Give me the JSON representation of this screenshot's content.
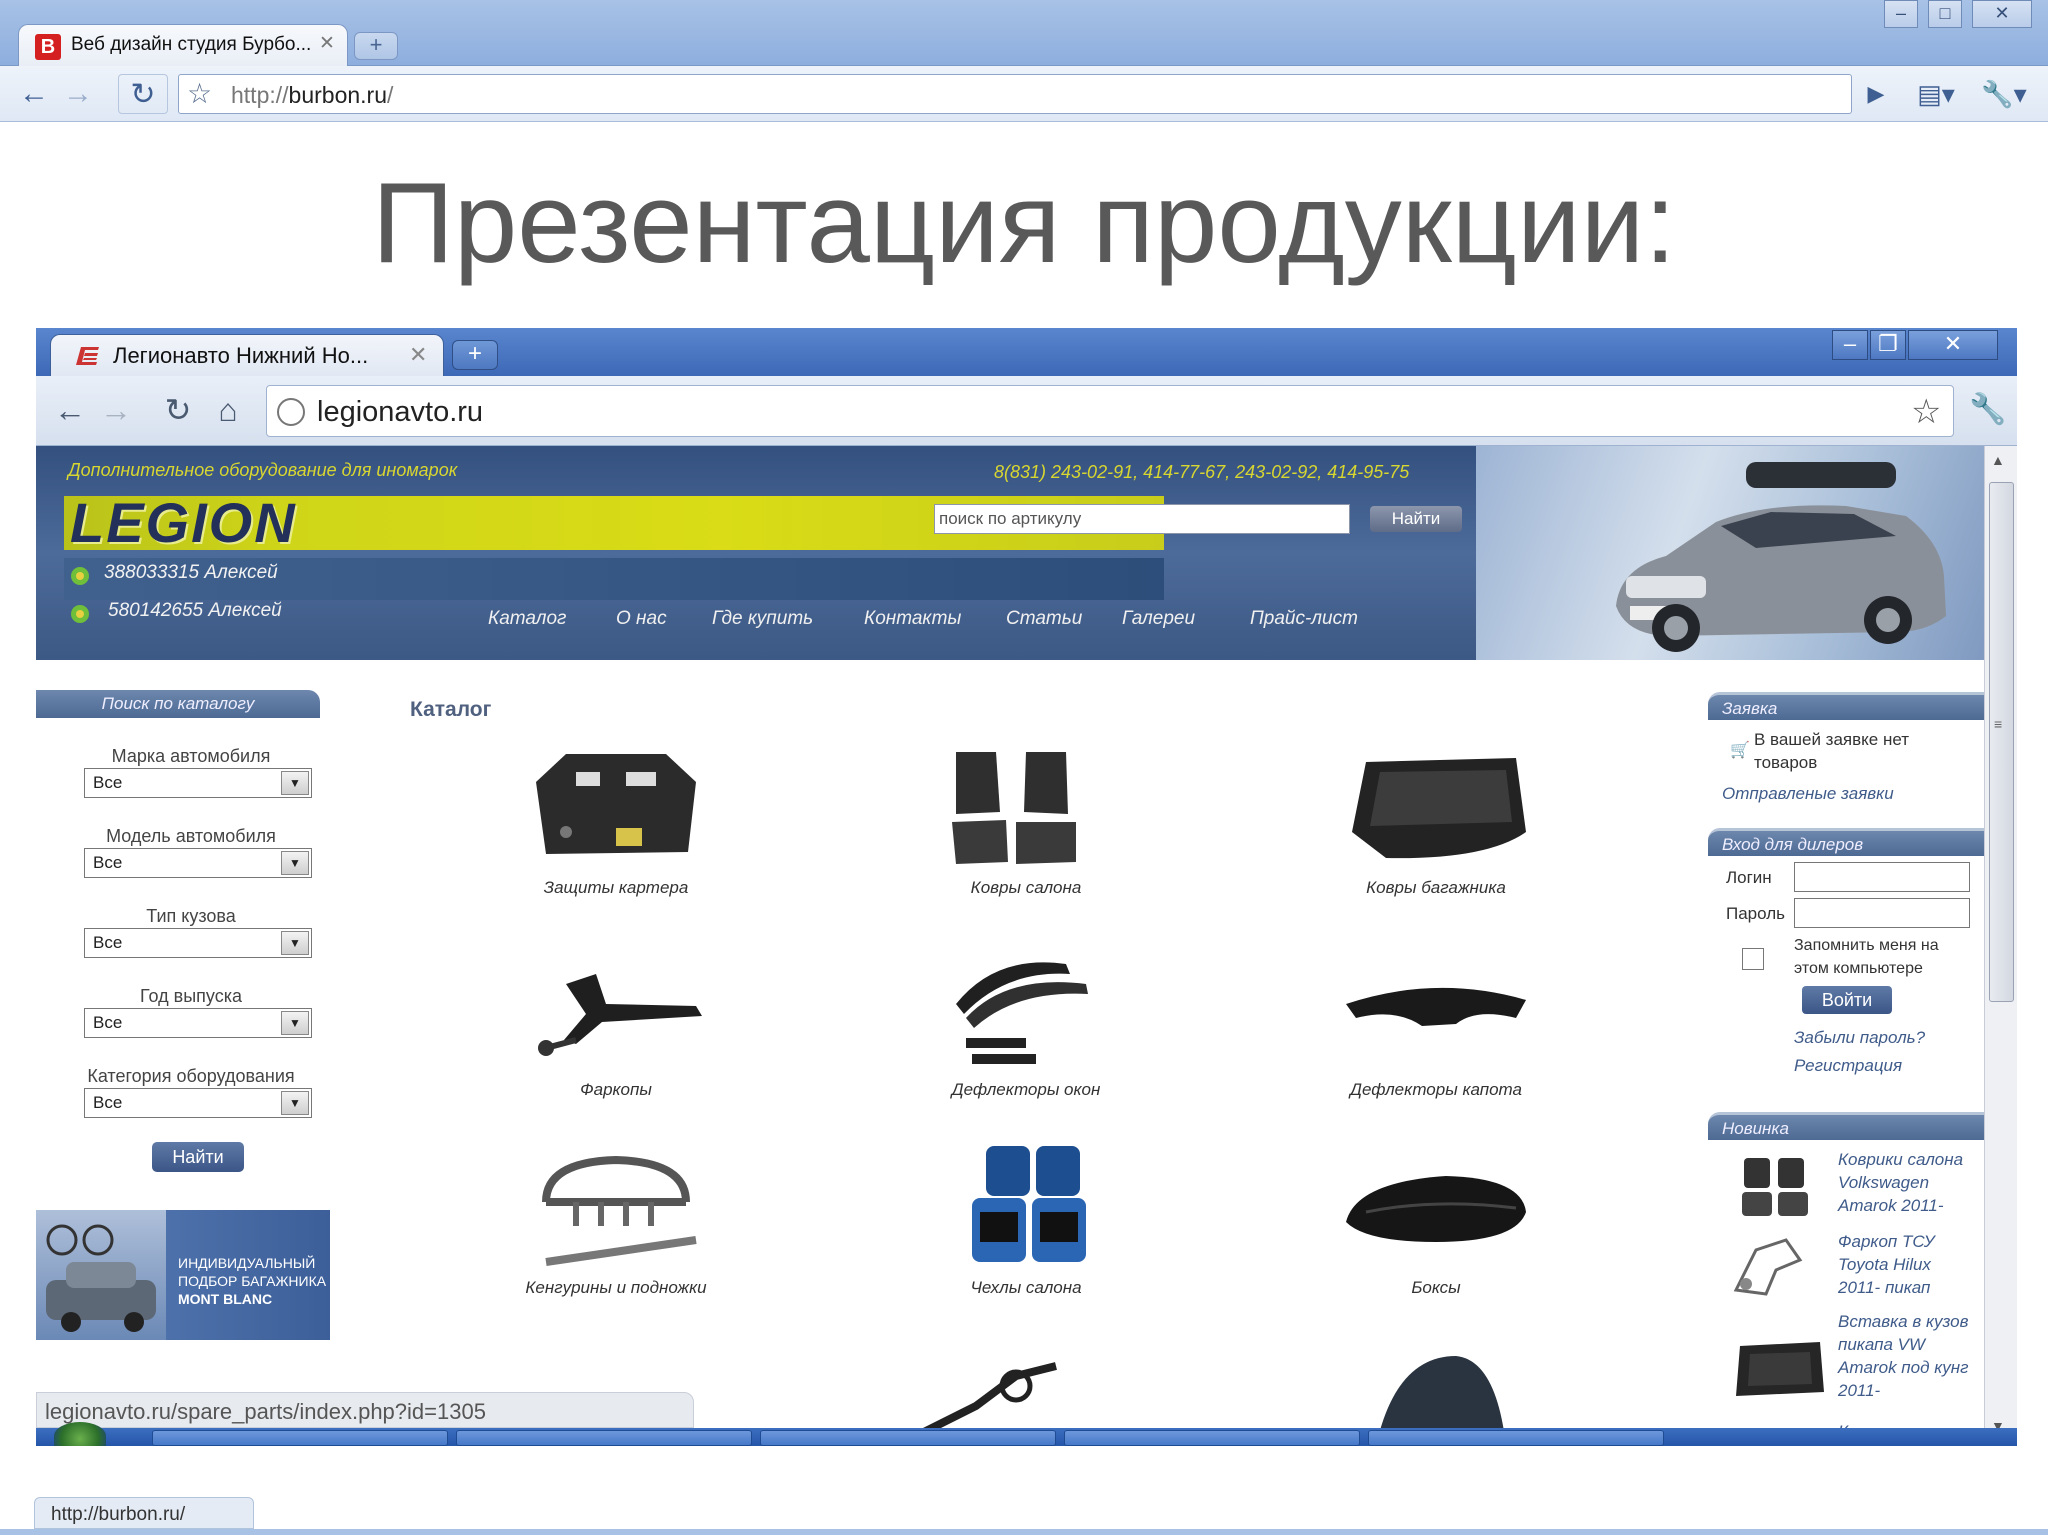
{
  "outer_browser": {
    "tab_title": "Веб дизайн студия Бурбо...",
    "favicon_letter": "B",
    "url_scheme": "http://",
    "url_host": "burbon.ru",
    "url_rest": "/",
    "status_url": "http://burbon.ru/"
  },
  "slide": {
    "heading": "Презентация продукции:"
  },
  "inner_browser": {
    "tab_title": "Легионавто Нижний Но...",
    "url": "legionavto.ru",
    "status_url": "legionavto.ru/spare_parts/index.php?id=1305"
  },
  "site": {
    "tagline": "Дополнительное оборудование для иномарок",
    "phones": "8(831) 243-02-91, 414-77-67, 243-02-92, 414-95-75",
    "logo": "LEGION",
    "search_placeholder": "поиск по артикулу",
    "search_button": "Найти",
    "icq": [
      "388033315 Алексей",
      "580142655  Алексей"
    ],
    "nav": [
      "Каталог",
      "О нас",
      "Где купить",
      "Контакты",
      "Статьи",
      "Галереи",
      "Прайс-лист"
    ]
  },
  "left_sidebar": {
    "heading": "Поиск по каталогу",
    "filters": [
      {
        "label": "Марка автомобиля",
        "value": "Все"
      },
      {
        "label": "Модель автомобиля",
        "value": "Все"
      },
      {
        "label": "Тип кузова",
        "value": "Все"
      },
      {
        "label": "Год выпуска",
        "value": "Все"
      },
      {
        "label": "Категория оборудования",
        "value": "Все"
      }
    ],
    "button": "Найти",
    "banner_lines": [
      "ИНДИВИДУАЛЬНЫЙ",
      "ПОДБОР БАГАЖНИКА",
      "MONT BLANC"
    ]
  },
  "catalog": {
    "title": "Каталог",
    "items": [
      "Защиты картера",
      "Ковры салона",
      "Ковры багажника",
      "Фаркопы",
      "Дефлекторы окон",
      "Дефлекторы капота",
      "Кенгурины и подножки",
      "Чехлы салона",
      "Боксы"
    ]
  },
  "right_sidebar": {
    "order_heading": "Заявка",
    "order_empty": [
      "В вашей заявке нет",
      "товаров"
    ],
    "order_link": "Отправленые заявки",
    "dealer_heading": "Вход для дилеров",
    "login_label": "Логин",
    "password_label": "Пароль",
    "remember": [
      "Запомнить меня на",
      "этом компьютере"
    ],
    "login_button": "Войти",
    "forgot_link": "Забыли пароль?",
    "register_link": "Регистрация",
    "new_heading": "Новинка",
    "new_items": [
      [
        "Коврики салона",
        "Volkswagen",
        "Amarok 2011-"
      ],
      [
        "Фаркоп ТСУ",
        "Toyota Hilux",
        "2011- пикап"
      ],
      [
        "Вставка в кузов",
        "пикапа VW",
        "Amarok под кунг",
        "2011-"
      ],
      [
        "Коврики салона"
      ]
    ]
  }
}
